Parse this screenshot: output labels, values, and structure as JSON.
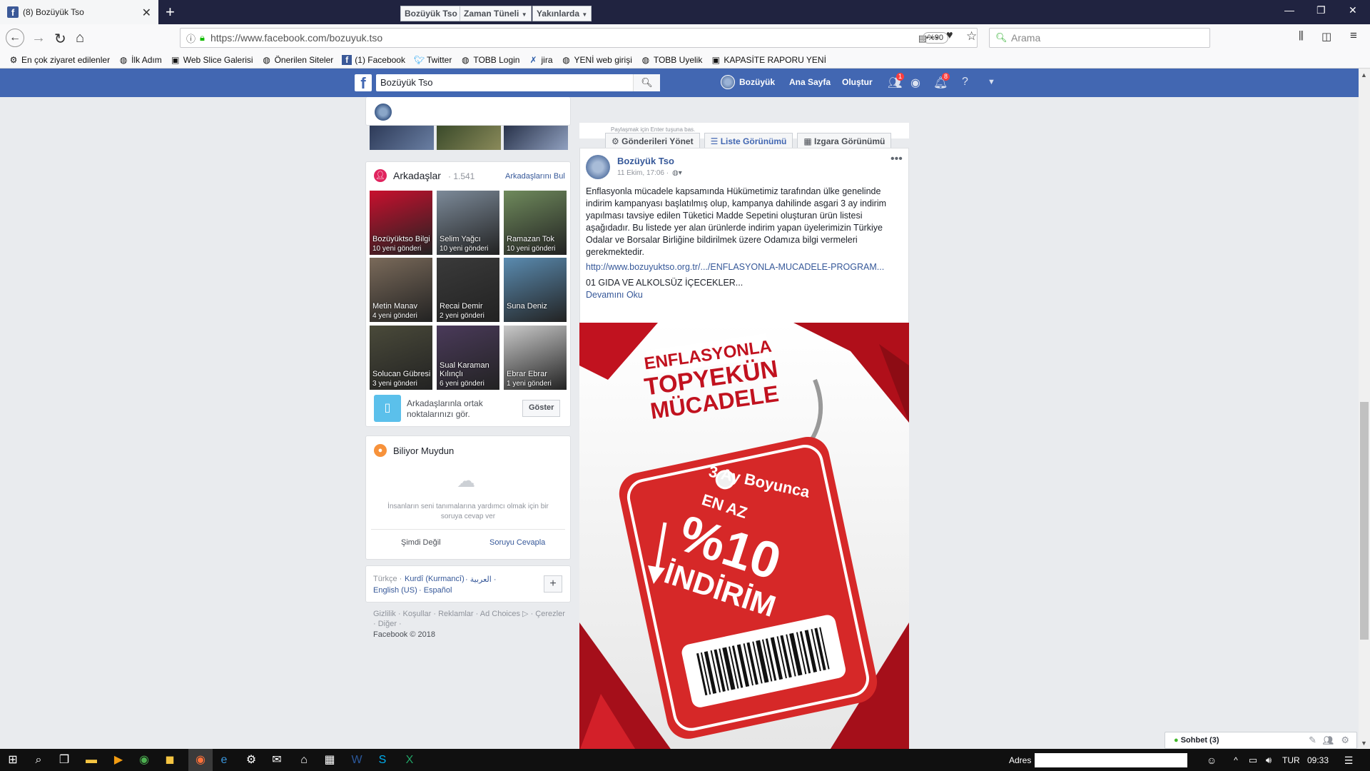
{
  "browser": {
    "tab_title": "(8) Bozüyük Tso",
    "url": "https://www.facebook.com/bozuyuk.tso",
    "zoom": "%90",
    "search_placeholder": "Arama"
  },
  "bookmarks": [
    {
      "label": "En çok ziyaret edilenler",
      "icon": "gear-icon"
    },
    {
      "label": "İlk Adım",
      "icon": "globe-icon"
    },
    {
      "label": "Web Slice Galerisi",
      "icon": "webslice-icon"
    },
    {
      "label": "Önerilen Siteler",
      "icon": "globe-icon"
    },
    {
      "label": "(1) Facebook",
      "icon": "facebook-icon"
    },
    {
      "label": "Twitter",
      "icon": "twitter-icon"
    },
    {
      "label": "TOBB Login",
      "icon": "globe-icon"
    },
    {
      "label": "jira",
      "icon": "jira-icon"
    },
    {
      "label": "YENİ web girişi",
      "icon": "globe-icon"
    },
    {
      "label": "TOBB Uyelik",
      "icon": "globe-icon"
    },
    {
      "label": "KAPASİTE RAPORU YENİ",
      "icon": "webslice-icon"
    }
  ],
  "fb_header": {
    "search_value": "Bozüyük Tso",
    "profile_name": "Bozüyük",
    "home": "Ana Sayfa",
    "create": "Oluştur",
    "friend_badge": "1",
    "notif_badge": "8"
  },
  "page_nav": {
    "name": "Bozüyük Tso",
    "timeline": "Zaman Tüneli",
    "nearby": "Yakınlarda"
  },
  "friends": {
    "title": "Arkadaşlar",
    "count": "· 1.541",
    "find_link": "Arkadaşlarını Bul",
    "items": [
      {
        "name": "Bozüyüktso Bilgi",
        "sub": "10 yeni gönderi",
        "color": "#c8102e"
      },
      {
        "name": "Selim Yağcı",
        "sub": "10 yeni gönderi",
        "color": "#7c8a99"
      },
      {
        "name": "Ramazan Tok",
        "sub": "10 yeni gönderi",
        "color": "#6f8a5c"
      },
      {
        "name": "Metin Manav",
        "sub": "4 yeni gönderi",
        "color": "#7a6a5a"
      },
      {
        "name": "Recai Demir",
        "sub": "2 yeni gönderi",
        "color": "#3a3a3a"
      },
      {
        "name": "Suna Deniz",
        "sub": "",
        "color": "#5a8bb0"
      },
      {
        "name": "Solucan Gübresi",
        "sub": "3 yeni gönderi",
        "color": "#4a4a3a"
      },
      {
        "name": "Sual Karaman Kılınçlı",
        "sub": "6 yeni gönderi",
        "color": "#4a3a5a"
      },
      {
        "name": "Ebrar Ebrar",
        "sub": "1 yeni gönderi",
        "color": "#c9c9c9"
      }
    ],
    "mutual_text": "Arkadaşlarınla ortak noktalarınızı gör.",
    "mutual_button": "Göster"
  },
  "did_you_know": {
    "title": "Biliyor Muydun",
    "prompt": "İnsanların seni tanımalarına yardımcı olmak için bir soruya cevap ver",
    "not_now": "Şimdi Değil",
    "answer": "Soruyu Cevapla"
  },
  "languages": {
    "current": "Türkçe ·",
    "kurdi": "Kurdî (Kurmancî)",
    "arabic": "· العربية ·",
    "english": "English (US)",
    "spanish": "· Español",
    "plus": "+"
  },
  "footer": {
    "line1": "Gizlilik · Koşullar · Reklamlar · Ad Choices ▷ · Çerezler",
    "line2": "· Diğer ·",
    "copyright": "Facebook © 2018"
  },
  "view_bar": {
    "hint": "Paylaşmak için Enter tuşuna bas.",
    "manage": "Gönderileri Yönet",
    "list": "Liste Görünümü",
    "grid": "Izgara Görünümü"
  },
  "post": {
    "author": "Bozüyük Tso",
    "time": "11 Ekim, 17:06 ·",
    "body": "Enflasyonla mücadele kapsamında Hükümetimiz tarafından ülke genelinde indirim kampanyası başlatılmış olup, kampanya dahilinde asgari 3 ay indirim yapılması tavsiye edilen Tüketici Madde Sepetini oluşturan ürün listesi aşağıdadır. Bu listede yer alan ürünlerde indirim yapan üyelerimizin Türkiye Odalar ve Borsalar Birliğine bildirilmek üzere Odamıza bilgi vermeleri gerekmektedir.",
    "link": "http://www.bozuyuktso.org.tr/.../ENFLASYONLA-MUCADELE-PROGRAM...",
    "list_item": "01 GIDA VE ALKOLSÜZ İÇECEKLER...",
    "read_more": "Devamını Oku"
  },
  "promo": {
    "line1": "ENFLASYONLA",
    "line2": "TOPYEKÜN",
    "line3": "MÜCADELE",
    "period": "3 Ay Boyunca",
    "min": "EN AZ",
    "percent": "%10",
    "word": "İNDİRİM"
  },
  "chat": {
    "label": "Sohbet (3)"
  },
  "taskbar": {
    "address_label": "Adres",
    "lang": "TUR",
    "time": "09:33"
  }
}
